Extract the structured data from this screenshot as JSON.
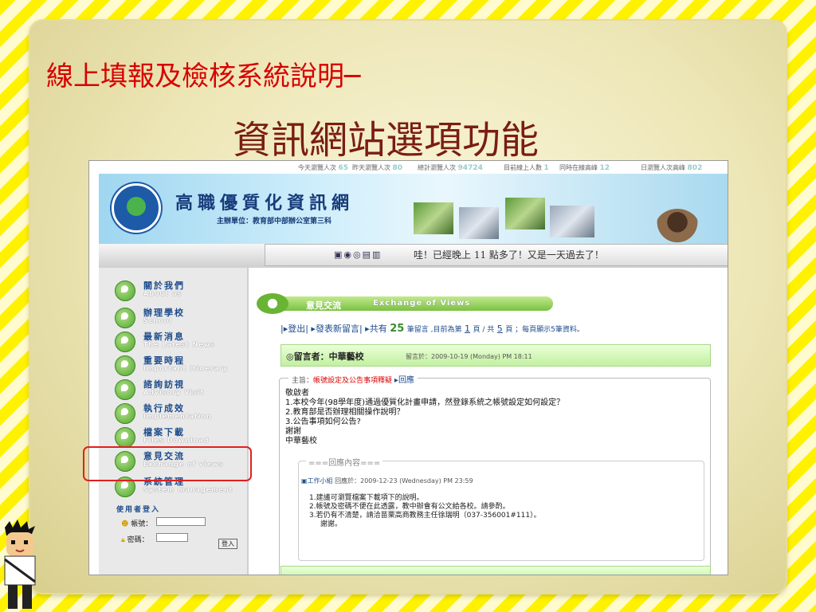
{
  "slide": {
    "title_line1": "線上填報及檢核系統說明─",
    "title_line2": "資訊網站選項功能"
  },
  "stats": [
    {
      "label": "今天瀏覽人次",
      "value": "65"
    },
    {
      "label": "昨天瀏覽人次",
      "value": "80"
    },
    {
      "label": "總計瀏覽人次",
      "value": "94724"
    },
    {
      "label": "目前線上人數",
      "value": "1"
    },
    {
      "label": "同時在線高峰",
      "value": "12"
    },
    {
      "label": "日瀏覽人次高峰",
      "value": "802"
    }
  ],
  "site": {
    "title": "高職優質化資訊網",
    "subtitle": "主辦單位：教育部中部辦公室第三科"
  },
  "marquee": {
    "text": "哇！已經晚上 11 點多了！又是一天過去了！"
  },
  "nav": [
    {
      "zh": "關於我們",
      "en": "About us"
    },
    {
      "zh": "辦理學校",
      "en": "School"
    },
    {
      "zh": "最新消息",
      "en": "The Latest News"
    },
    {
      "zh": "重要時程",
      "en": "Important Itinerary"
    },
    {
      "zh": "諮詢訪視",
      "en": "Advisory Visit"
    },
    {
      "zh": "執行成效",
      "en": "Implementation"
    },
    {
      "zh": "檔案下載",
      "en": "Files Download"
    },
    {
      "zh": "意見交流",
      "en": "Exchange of views"
    },
    {
      "zh": "系統管理",
      "en": "System management"
    }
  ],
  "login": {
    "heading": "使用者登入",
    "account_label": "帳號：",
    "password_label": "密碼：",
    "button": "登入"
  },
  "section": {
    "zh": "意見交流",
    "en": "Exchange of Views"
  },
  "pager": {
    "logout": "登出",
    "new_post": "發表新留言",
    "total_prefix": "共有",
    "total": "25",
    "total_mid": "筆留言 ,目前為第",
    "current": "1",
    "of": "頁 / 共",
    "pages": "5",
    "suffix": "頁 ；每頁顯示5筆資料。"
  },
  "post": {
    "author_label": "◎留言者：中華藝校",
    "time": "留言於：2009-10-19 (Monday) PM 18:11",
    "topic_label": "主旨：",
    "topic": "帳號設定及公告事項釋疑",
    "reply_link": "回應",
    "body": [
      "敬啟者",
      "1.本校今年(98學年度)通過優質化計畫申請，然登錄系統之帳號設定如何設定？",
      "2.教育部是否辦理相關操作說明？",
      "3.公告事項如何公告?",
      "謝謝",
      "中華藝校"
    ],
    "reply_legend": "===回應內容===",
    "reply_author": "工作小組",
    "reply_time": "回應於：2009-12-23 (Wednesday) PM 23:59",
    "reply_body": [
      "1.建議可瀏覽檔案下載項下的說明。",
      "2.帳號及密碼不便在此透露，教中辦會有公文給各校。請參酌。",
      "3.若仍有不清楚，請洽苗栗高商教務主任徐瑞明（037-356001#111）。",
      "謝謝。"
    ]
  }
}
